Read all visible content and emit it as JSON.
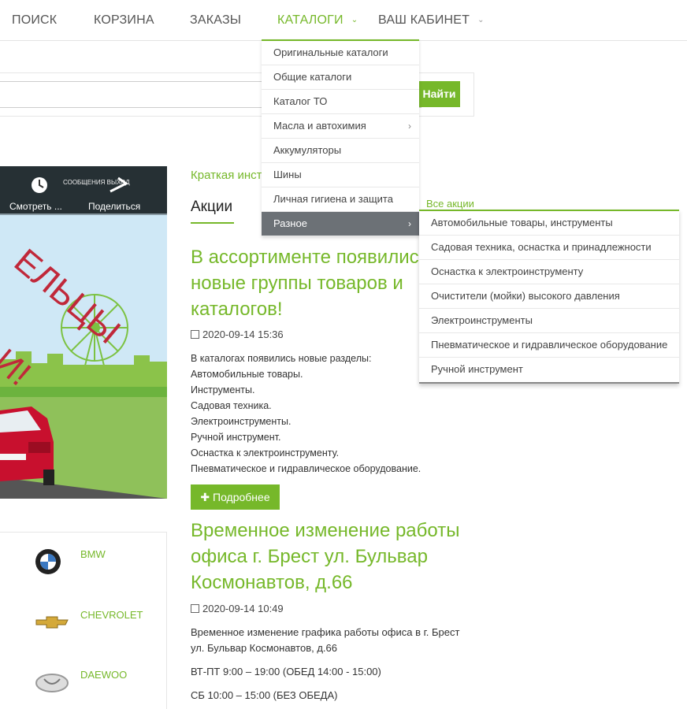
{
  "nav": {
    "search": "ПОИСК",
    "cart": "КОРЗИНА",
    "orders": "ЗАКАЗЫ",
    "catalogs": "КАТАЛОГИ",
    "cabinet": "ВАШ КАБИНЕТ"
  },
  "search": {
    "button": "Найти",
    "placeholder": ""
  },
  "video": {
    "watch_later": "Смотреть ...",
    "share": "Поделиться",
    "topbar": "СООБЩЕНИЯ   ВЫХОД",
    "overlay_text_1": "ЕЛЬЦЫ",
    "overlay_text_2": "И!"
  },
  "content": {
    "brief": "Краткая инст",
    "tab_promos": "Акции",
    "all_promos": "Все акции"
  },
  "news": [
    {
      "title": "В ассортименте появилис новые группы товаров и каталогов!",
      "date": "2020-09-14 15:36",
      "body": [
        "В каталогах появились новые разделы:",
        "Автомобильные товары.",
        "Инструменты.",
        "Садовая техника.",
        "Электроинструменты.",
        "Ручной инструмент.",
        "Оснастка к электроинструменту.",
        "Пневматическое и гидравлическое оборудование."
      ],
      "more": "Подробнее"
    },
    {
      "title": "Временное изменение работы офиса г. Брест ул. Бульвар Космонавтов, д.66",
      "date": "2020-09-14 10:49",
      "body": [
        "Временное изменение графика работы офиса в г. Брест",
        "ул. Бульвар Космонавтов, д.66",
        "ВТ-ПТ 9:00 – 19:00 (ОБЕД 14:00 - 15:00)",
        "СБ 10:00 – 15:00 (БЕЗ ОБЕДА)"
      ]
    }
  ],
  "brands": [
    "BMW",
    "CHEVROLET",
    "DAEWOO"
  ],
  "catalog_menu": [
    {
      "label": "Оригинальные каталоги",
      "submenu": false
    },
    {
      "label": "Общие каталоги",
      "submenu": false
    },
    {
      "label": "Каталог ТО",
      "submenu": false
    },
    {
      "label": "Масла и автохимия",
      "submenu": true
    },
    {
      "label": "Аккумуляторы",
      "submenu": false
    },
    {
      "label": "Шины",
      "submenu": false
    },
    {
      "label": "Личная гигиена и защита",
      "submenu": false
    },
    {
      "label": "Разное",
      "submenu": true
    }
  ],
  "misc_submenu": [
    "Автомобильные товары, инструменты",
    "Садовая техника, оснастка и принадлежности",
    "Оснастка к электроинструменту",
    "Очистители (мойки) высокого давления",
    "Электроинструменты",
    "Пневматическое и гидравлическое оборудование",
    "Ручной инструмент"
  ],
  "colors": {
    "accent": "#76b82a",
    "menu_active": "#6c7176"
  }
}
